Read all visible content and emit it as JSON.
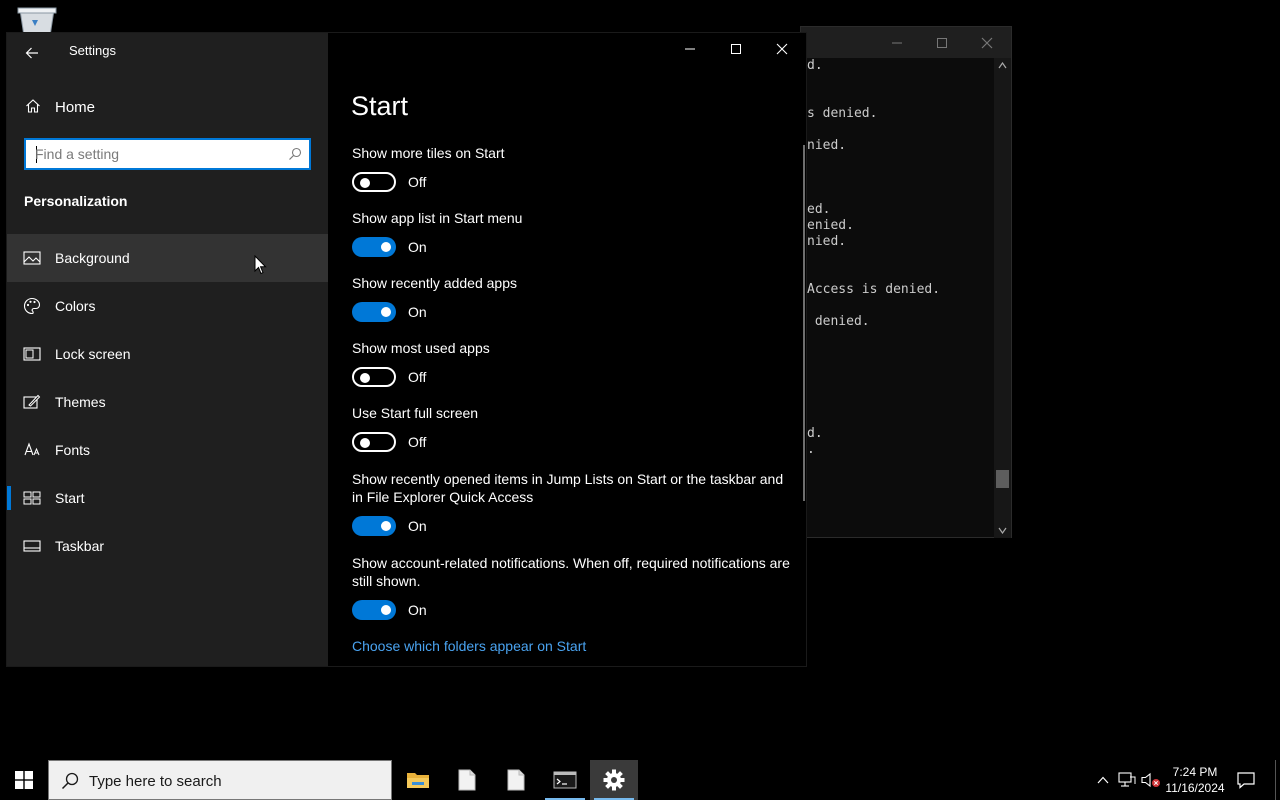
{
  "settings": {
    "title": "Settings",
    "home_label": "Home",
    "search_placeholder": "Find a setting",
    "section_label": "Personalization",
    "nav": [
      {
        "label": "Background",
        "icon": "picture-icon"
      },
      {
        "label": "Colors",
        "icon": "palette-icon"
      },
      {
        "label": "Lock screen",
        "icon": "lock-screen-icon"
      },
      {
        "label": "Themes",
        "icon": "themes-icon"
      },
      {
        "label": "Fonts",
        "icon": "fonts-icon"
      },
      {
        "label": "Start",
        "icon": "start-icon"
      },
      {
        "label": "Taskbar",
        "icon": "taskbar-icon"
      }
    ],
    "hovered_item": "Background",
    "selected_item": "Start",
    "page_title": "Start",
    "options": [
      {
        "label": "Show more tiles on Start",
        "state": "Off"
      },
      {
        "label": "Show app list in Start menu",
        "state": "On"
      },
      {
        "label": "Show recently added apps",
        "state": "On"
      },
      {
        "label": "Show most used apps",
        "state": "Off"
      },
      {
        "label": "Use Start full screen",
        "state": "Off"
      },
      {
        "label": "Show recently opened items in Jump Lists on Start or the taskbar and in File Explorer Quick Access",
        "state": "On"
      },
      {
        "label": "Show account-related notifications. When off, required notifications are still shown.",
        "state": "On"
      }
    ],
    "link_label": "Choose which folders appear on Start"
  },
  "console": {
    "lines": [
      "d.",
      "",
      "",
      "s denied.",
      "",
      "nied.",
      "",
      "",
      "",
      "ed.",
      "enied.",
      "nied.",
      "",
      "",
      "Access is denied.",
      "",
      " denied.",
      "",
      "",
      "",
      "",
      "",
      "",
      "d.",
      "."
    ]
  },
  "taskbar": {
    "search_placeholder": "Type here to search",
    "apps": [
      "file-explorer-icon",
      "document-icon",
      "document-icon",
      "console-icon",
      "settings-gear-icon"
    ],
    "time": "7:24 PM",
    "date": "11/16/2024"
  },
  "colors": {
    "accent": "#0078d7",
    "link": "#4aa3f0",
    "sidebar": "#1f1f1f"
  }
}
